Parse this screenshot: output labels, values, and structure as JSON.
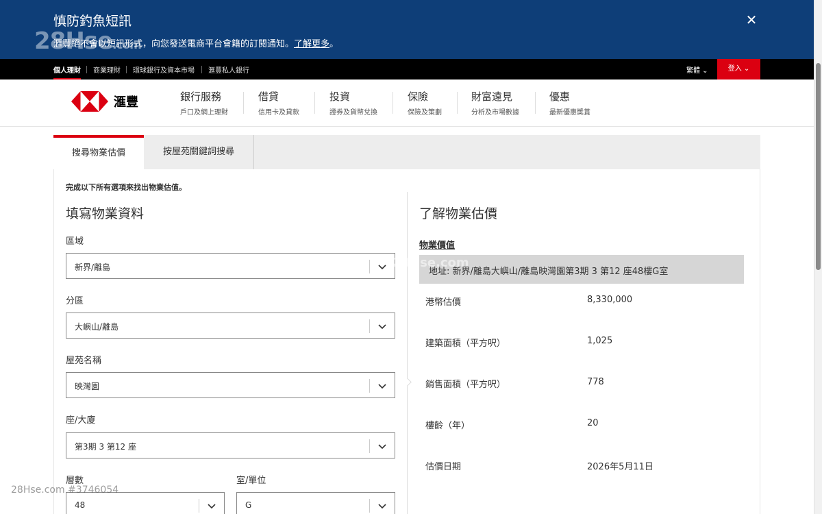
{
  "notice": {
    "title": "慎防釣魚短訊",
    "body": "滙豐絕不會以短訊形式，向您發送電商平台會籍的訂閱通知。",
    "link": "了解更多",
    "body_end": "。",
    "watermark": "28Hse",
    "watermark_suffix": ".com"
  },
  "topnav": {
    "items": [
      "個人理財",
      "商業理財",
      "環球銀行及資本市場",
      "滙豐私人銀行"
    ],
    "language": "繁體 ⌄",
    "login": "登入 ⌄"
  },
  "brand": {
    "name": "滙豐"
  },
  "mainnav": [
    {
      "title": "銀行服務",
      "sub": "戶口及網上理財"
    },
    {
      "title": "借貸",
      "sub": "信用卡及貸款"
    },
    {
      "title": "投資",
      "sub": "證券及貨幣兌換"
    },
    {
      "title": "保險",
      "sub": "保險及策劃"
    },
    {
      "title": "財富遠見",
      "sub": "分析及市場數據"
    },
    {
      "title": "優惠",
      "sub": "最新優惠獎賞"
    }
  ],
  "tabs": [
    "搜尋物業估價",
    "按屋苑關鍵詞搜尋"
  ],
  "instruction": "完成以下所有選項來找出物業估值。",
  "form": {
    "title": "填寫物業資料",
    "fields": [
      {
        "label": "區域",
        "value": "新界/離島"
      },
      {
        "label": "分區",
        "value": "大嶼山/離島"
      },
      {
        "label": "屋苑名稱",
        "value": "映灣園"
      },
      {
        "label": "座/大廈",
        "value": "第3期 3 第12 座"
      },
      {
        "label": "層數",
        "value": "48"
      },
      {
        "label": "室/單位",
        "value": "G"
      }
    ]
  },
  "result": {
    "title": "了解物業估價",
    "heading": "物業價值",
    "address": "地址: 新界/離島大嶼山/離島映灣園第3期 3 第12 座48樓G室",
    "rows": [
      {
        "label": "港幣估價",
        "value": "8,330,000"
      },
      {
        "label": "建築面積（平方呎）",
        "value": "1,025"
      },
      {
        "label": "銷售面積（平方呎）",
        "value": "778"
      },
      {
        "label": "樓齡（年）",
        "value": "20"
      },
      {
        "label": "估價日期",
        "value": "2026年5月11日"
      }
    ]
  },
  "watermarks": {
    "bottom": "28Hse.com #3746054",
    "middle": "28Hse.com"
  },
  "colors": {
    "banner": "#0e3e78",
    "brand_red": "#db0011",
    "topnav": "#000000",
    "address_bg": "#d6d6d6"
  }
}
